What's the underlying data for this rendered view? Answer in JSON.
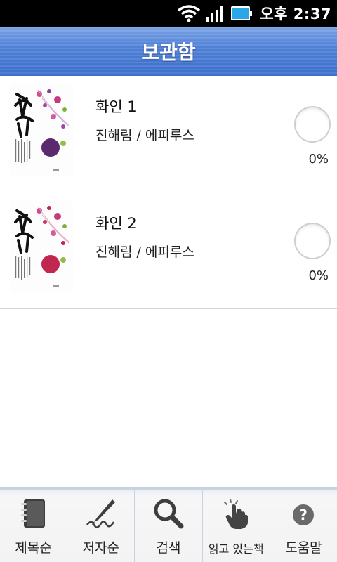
{
  "status_bar": {
    "time": "오후 2:37",
    "icons": [
      "wifi-icon",
      "signal-icon",
      "battery-icon"
    ]
  },
  "header": {
    "title": "보관함"
  },
  "books": [
    {
      "title": "화인 1",
      "author_publisher": "진해림 / 에피루스",
      "progress_text": "0%",
      "progress": 0,
      "cover_accent": "#5b2a6e"
    },
    {
      "title": "화인 2",
      "author_publisher": "진해림 / 에피루스",
      "progress_text": "0%",
      "progress": 0,
      "cover_accent": "#c0284f"
    }
  ],
  "tabs": [
    {
      "label": "제목순",
      "icon": "notebook-icon"
    },
    {
      "label": "저자순",
      "icon": "pen-icon"
    },
    {
      "label": "검색",
      "icon": "magnifier-icon"
    },
    {
      "label": "읽고 있는책",
      "icon": "touch-hand-icon"
    },
    {
      "label": "도움말",
      "icon": "help-icon"
    }
  ],
  "colors": {
    "header_blue": "#4d7fd6",
    "status_bg": "#000000"
  }
}
